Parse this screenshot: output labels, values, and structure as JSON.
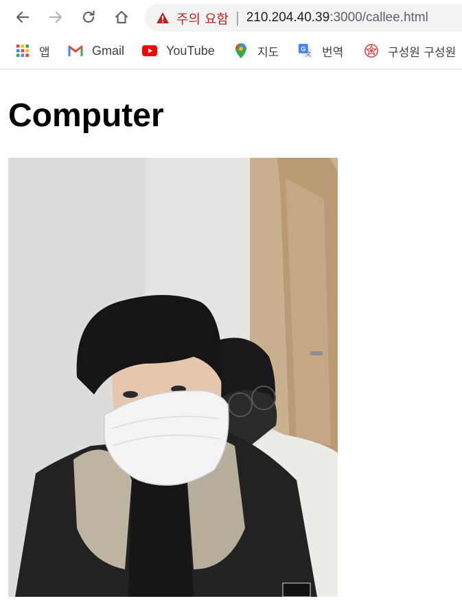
{
  "browser": {
    "security_warning": "주의 요함",
    "url_host": "210.204.40.39",
    "url_path": ":3000/callee.html"
  },
  "bookmarks": [
    {
      "label": "앱",
      "icon": "apps-grid-icon"
    },
    {
      "label": "Gmail",
      "icon": "gmail-icon"
    },
    {
      "label": "YouTube",
      "icon": "youtube-icon"
    },
    {
      "label": "지도",
      "icon": "maps-pin-icon"
    },
    {
      "label": "번역",
      "icon": "translate-icon"
    },
    {
      "label": "구성원 구성원",
      "icon": "org-emblem-icon"
    }
  ],
  "page": {
    "title": "Computer"
  },
  "colors": {
    "warning_red": "#c5221f",
    "youtube_red": "#ff0000",
    "gmail_red": "#ea4335",
    "maps_green": "#34a853",
    "translate_blue": "#4285f4"
  }
}
